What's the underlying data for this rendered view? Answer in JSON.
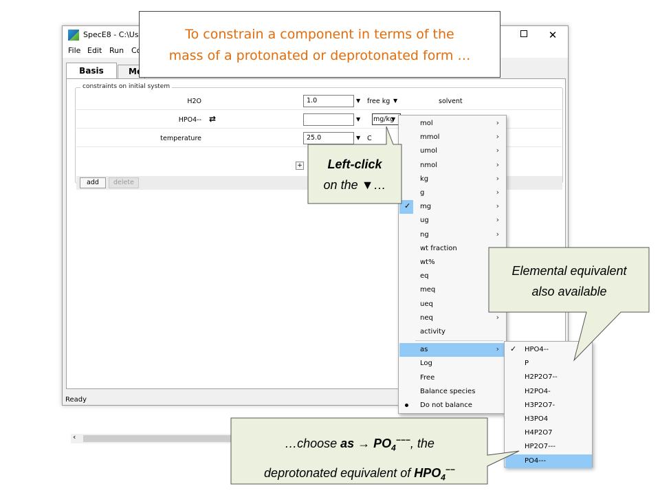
{
  "window": {
    "title": "SpecE8 - C:\\Users",
    "maximize_glyph": "",
    "close_glyph": "✕"
  },
  "menubar": {
    "items": [
      "File",
      "Edit",
      "Run",
      "Co"
    ]
  },
  "tabs": [
    {
      "label": "Basis",
      "active": true
    },
    {
      "label": "Me",
      "active": false
    }
  ],
  "constraints": {
    "group_label": "constraints on initial system",
    "rows": [
      {
        "label": "H2O",
        "value": "1.0",
        "unit": "free kg",
        "note": "solvent"
      },
      {
        "label": "HPO4--",
        "value": "",
        "unit": "mg/kg",
        "note": ""
      },
      {
        "label": "temperature",
        "value": "25.0",
        "unit": "C",
        "note": ""
      }
    ],
    "add_row_button": "+",
    "add_row_label": "a"
  },
  "buttons": {
    "add": "add",
    "delete": "delete"
  },
  "status": "Ready",
  "unit_menu": {
    "items": [
      {
        "label": "mol",
        "submenu": true
      },
      {
        "label": "mmol",
        "submenu": true
      },
      {
        "label": "umol",
        "submenu": true
      },
      {
        "label": "nmol",
        "submenu": true
      },
      {
        "label": "kg",
        "submenu": true
      },
      {
        "label": "g",
        "submenu": true
      },
      {
        "label": "mg",
        "submenu": true,
        "checked": true
      },
      {
        "label": "ug",
        "submenu": true
      },
      {
        "label": "ng",
        "submenu": true
      },
      {
        "label": "wt fraction"
      },
      {
        "label": "wt%"
      },
      {
        "label": "eq"
      },
      {
        "label": "meq"
      },
      {
        "label": "ueq"
      },
      {
        "label": "neq",
        "submenu": true
      },
      {
        "label": "activity"
      },
      {
        "label": "as",
        "submenu": true,
        "highlighted": true
      },
      {
        "label": "Log"
      },
      {
        "label": "Free"
      },
      {
        "label": "Balance species"
      },
      {
        "label": "Do not balance",
        "selected_dot": true
      }
    ]
  },
  "species_menu": {
    "items": [
      {
        "label": "HPO4--",
        "checked": true
      },
      {
        "label": "P"
      },
      {
        "label": "H2P2O7--"
      },
      {
        "label": "H2PO4-"
      },
      {
        "label": "H3P2O7-"
      },
      {
        "label": "H3PO4"
      },
      {
        "label": "H4P2O7"
      },
      {
        "label": "HP2O7---"
      },
      {
        "label": "PO4---",
        "highlighted": true
      }
    ]
  },
  "callouts": {
    "title": {
      "line1": "To constrain a component in terms of the",
      "line2": "mass of a protonated or deprotonated form …"
    },
    "left_click": {
      "bold": "Left-click",
      "line2_prefix": "on the",
      "glyph": "▼",
      "line2_suffix": "…"
    },
    "elemental": {
      "line1": "Elemental equivalent",
      "line2": "also available"
    },
    "choose": {
      "p1": "…choose ",
      "as": "as",
      "arrow": " → ",
      "po4_base": "PO",
      "po4_sub": "4",
      "po4_sup": "−−−",
      "p2": ", the",
      "p3": "deprotonated equivalent of ",
      "hpo4_base": "HPO",
      "hpo4_sub": "4",
      "hpo4_sup": "−−"
    }
  },
  "colors": {
    "callout_fill": "#ebf1de",
    "title_text": "#e46c0a",
    "menu_highlight": "#91c9f7"
  }
}
